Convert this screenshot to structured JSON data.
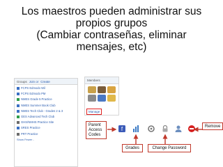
{
  "title": {
    "line1": "Los maestros pueden administrar sus",
    "line2": "propios grupos",
    "line3": "(Cambiar contraseñas, eliminar",
    "line4": "mensajes, etc)"
  },
  "groups": {
    "header": "Groups",
    "join_label": "Join or",
    "create_label": "Create",
    "items": [
      {
        "label": "FCPS Edmodo Wil",
        "color": "#3a6fc4"
      },
      {
        "label": "FCPS Edmodo PM",
        "color": "#3a6fc4"
      },
      {
        "label": "NMES Grade 5 Practice",
        "color": "#2d9c4a"
      },
      {
        "label": "NMES Summer Book Club",
        "color": "#3a6fc4"
      },
      {
        "label": "NMES Tech Club - Grades 2 & 3",
        "color": "#3a6fc4"
      },
      {
        "label": "GES Advanced Tech Club",
        "color": "#2d9c4a"
      },
      {
        "label": "GHS/NMHS Practice Site",
        "color": "#6b6b6b"
      },
      {
        "label": "SRES Practice",
        "color": "#3a6fc4"
      },
      {
        "label": "PRT Practice",
        "color": "#6b6b6b"
      }
    ],
    "show_fewer": "Show Fewer -"
  },
  "members": {
    "header": "Members",
    "manage": "Manage"
  },
  "annotations": {
    "parent_access_codes": "Parent Access Codes",
    "remove": "Remove",
    "grades": "Grades",
    "change_password": "Change Password"
  },
  "colors": {
    "callout_border": "#c0392b",
    "arrow": "#c0392b",
    "link": "#2a5db0"
  }
}
